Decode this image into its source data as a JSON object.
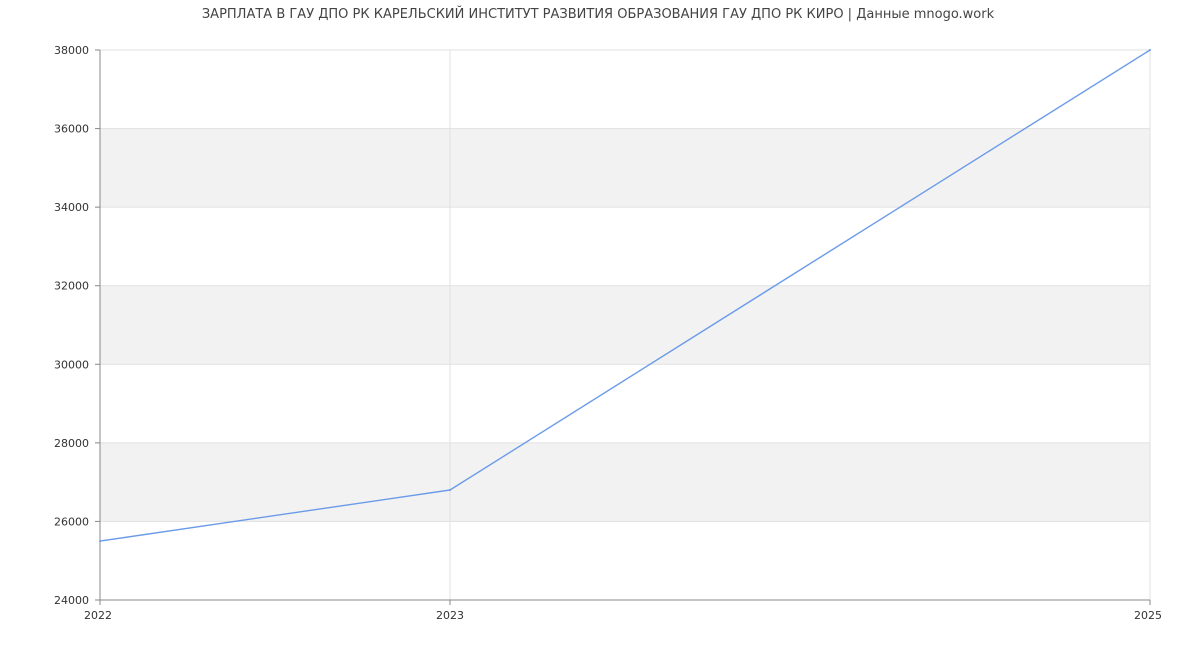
{
  "chart_data": {
    "type": "line",
    "title": "ЗАРПЛАТА В ГАУ ДПО РК КАРЕЛЬСКИЙ ИНСТИТУТ РАЗВИТИЯ ОБРАЗОВАНИЯ ГАУ ДПО РК КИРО | Данные mnogo.work",
    "xlabel": "",
    "ylabel": "",
    "x": [
      2022,
      2023,
      2025
    ],
    "x_ticks": [
      "2022",
      "2023",
      "2025"
    ],
    "y_ticks": [
      "24000",
      "26000",
      "28000",
      "30000",
      "32000",
      "34000",
      "36000",
      "38000"
    ],
    "ylim": [
      24000,
      38000
    ],
    "series": [
      {
        "values": [
          25500,
          26800,
          38000
        ]
      }
    ],
    "grid": true,
    "colors": {
      "line": "#6b9be8",
      "band": "#f2f2f2",
      "grid": "#e0e0e0",
      "axis": "#888888"
    }
  }
}
